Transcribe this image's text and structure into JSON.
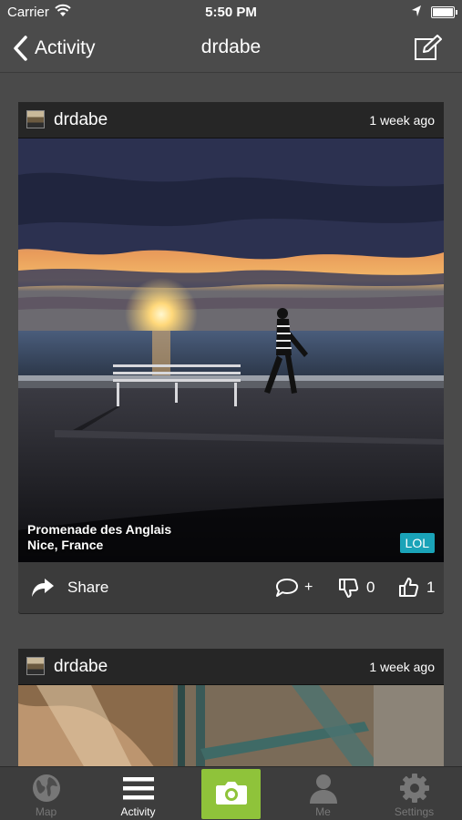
{
  "status_bar": {
    "carrier": "Carrier",
    "time": "5:50 PM"
  },
  "nav": {
    "back_label": "Activity",
    "title": "drdabe"
  },
  "posts": [
    {
      "user": "drdabe",
      "time_ago": "1 week ago",
      "caption_line1": "Promenade des Anglais",
      "caption_line2": "Nice, France",
      "tag": "LOL",
      "share_label": "Share",
      "comment_plus": "+",
      "dislikes": "0",
      "likes": "1"
    },
    {
      "user": "drdabe",
      "time_ago": "1 week ago"
    }
  ],
  "tabs": [
    {
      "label": "Map",
      "icon": "globe-icon"
    },
    {
      "label": "Activity",
      "icon": "list-icon"
    },
    {
      "label": "",
      "icon": "camera-icon"
    },
    {
      "label": "Me",
      "icon": "person-icon"
    },
    {
      "label": "Settings",
      "icon": "gear-icon"
    }
  ],
  "colors": {
    "accent_green": "#8fc33a",
    "tag_teal": "#1aa3b8",
    "background": "#4a4a4a"
  }
}
